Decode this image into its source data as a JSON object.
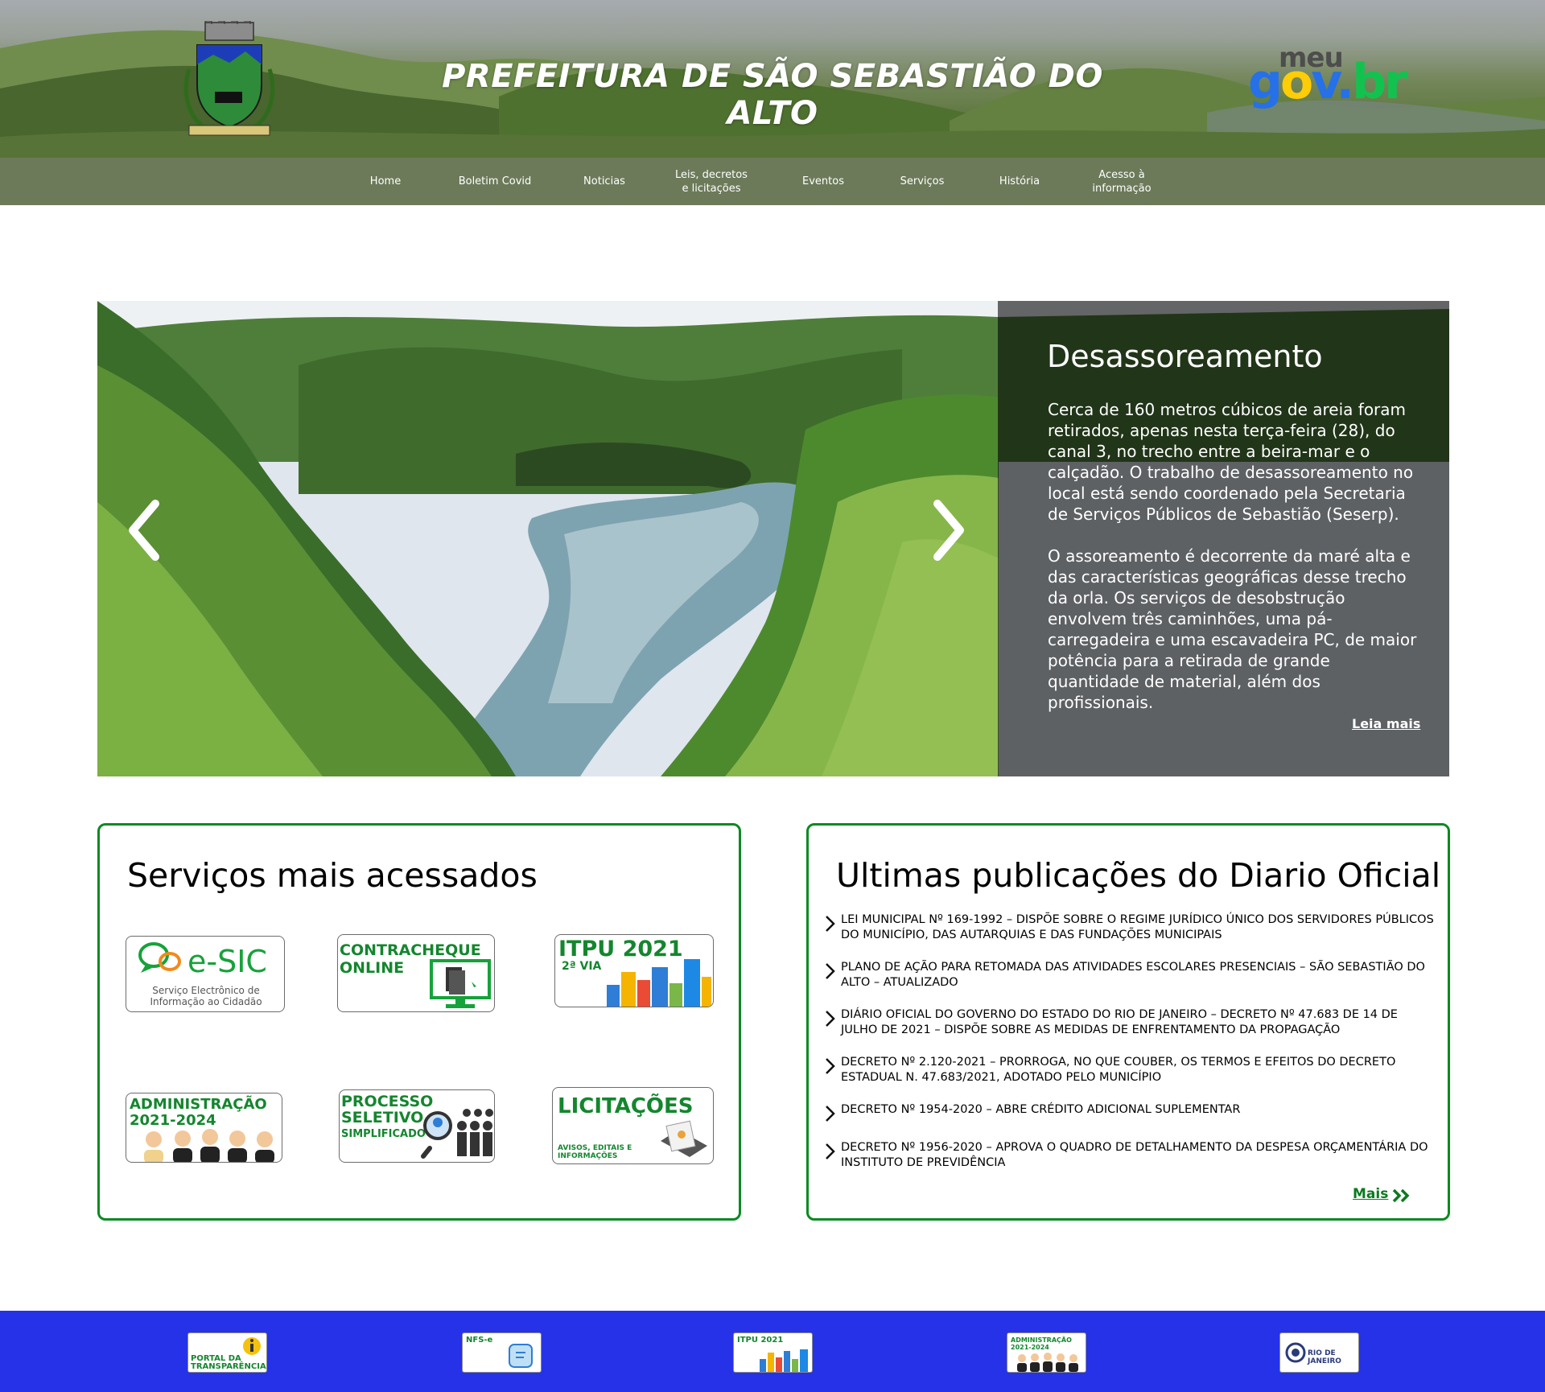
{
  "header": {
    "title": "PREFEITURA DE SÃO SEBASTIÃO DO ALTO",
    "logo_icon": "municipal-coat-of-arms",
    "govbr": {
      "top": "meu",
      "letters": [
        "g",
        "o",
        "v",
        ".",
        "b",
        "r"
      ],
      "colors": [
        "#2670e8",
        "#ffcd07",
        "#2670e8",
        "#2670e8",
        "#12c24f",
        "#12c24f"
      ]
    }
  },
  "nav": {
    "items": [
      {
        "label": "Home"
      },
      {
        "label": "Boletim Covid"
      },
      {
        "label": "Noticias"
      },
      {
        "label": "Leis, decretos\ne licitações"
      },
      {
        "label": "Eventos"
      },
      {
        "label": "Serviços"
      },
      {
        "label": "História"
      },
      {
        "label": "Acesso à\ninformação"
      }
    ]
  },
  "carousel": {
    "title": "Desassoreamento",
    "paragraph_1": "Cerca de 160 metros cúbicos de areia foram retirados, apenas nesta terça-feira (28), do canal 3, no trecho entre a beira-mar e o calçadão. O trabalho de desassoreamento no local está sendo coordenado pela Secretaria de Serviços Públicos de Sebastião (Seserp).",
    "paragraph_2": "O assoreamento é decorrente da maré alta e das características geográficas desse trecho da orla. Os serviços de desobstrução envolvem três caminhões, uma pá-carregadeira e uma escavadeira PC, de maior potência para a retirada de grande quantidade de material, além dos profissionais.",
    "read_more": "Leia mais",
    "prev_icon": "chevron-left-icon",
    "next_icon": "chevron-right-icon"
  },
  "services": {
    "title": "Serviços mais acessados",
    "esic": {
      "name": "e-SIC",
      "subtitle": "Serviço Electrônico de\nInformação ao Cidadão"
    },
    "contracheque": {
      "name": "CONTRACHEQUE\nONLINE"
    },
    "itpu": {
      "name": "ITPU 2021",
      "sub": "2ª VIA"
    },
    "administracao": {
      "name": "ADMINISTRAÇÃO\n2021-2024"
    },
    "processo": {
      "name": "PROCESSO\nSELETIVO",
      "sub": "SIMPLIFICADO"
    },
    "licitacoes": {
      "name": "LICITAÇÕES",
      "sub": "AVISOS, EDITAIS E\nINFORMAÇÕES"
    }
  },
  "diario": {
    "title": "Ultimas publicações do Diario Oficial",
    "items": [
      {
        "text": "LEI MUNICIPAL Nº 169-1992 – DISPÕE SOBRE O REGIME JURÍDICO ÚNICO DOS SERVIDORES PÚBLICOS DO MUNICÍPIO, DAS AUTARQUIAS E DAS FUNDAÇÕES MUNICIPAIS"
      },
      {
        "text": "PLANO DE AÇÃO PARA RETOMADA DAS ATIVIDADES ESCOLARES PRESENCIAIS – SÃO SEBASTIÃO DO ALTO – ATUALIZADO"
      },
      {
        "text": "DIÁRIO OFICIAL DO GOVERNO DO ESTADO DO RIO DE JANEIRO –  DECRETO Nº 47.683 DE 14 DE JULHO DE 2021 – DISPÕE SOBRE AS MEDIDAS DE ENFRENTAMENTO DA PROPAGAÇÃO"
      },
      {
        "text": "DECRETO Nº 2.120-2021 – PRORROGA, NO QUE COUBER, OS TERMOS E EFEITOS DO DECRETO ESTADUAL N. 47.683/2021, ADOTADO PELO MUNICÍPIO"
      },
      {
        "text": "DECRETO Nº 1954-2020 – ABRE CRÉDITO ADICIONAL SUPLEMENTAR"
      },
      {
        "text": "DECRETO Nº 1956-2020 – APROVA O QUADRO DE DETALHAMENTO DA DESPESA ORÇAMENTÁRIA DO INSTITUTO DE PREVIDÊNCIA"
      }
    ],
    "more": "Mais"
  },
  "footer": {
    "links": [
      {
        "label": "PORTAL DA\nTRANSPARÊNCIA"
      },
      {
        "label": "NFS-e"
      },
      {
        "label": "ITPU 2021"
      },
      {
        "label": "ADMINISTRAÇÃO\n2021-2024"
      },
      {
        "label": "RIO DE JANEIRO"
      }
    ]
  },
  "colors": {
    "accent_green": "#0a8a22",
    "footer_blue": "#2532e8",
    "service_text_green": "#14862e"
  }
}
